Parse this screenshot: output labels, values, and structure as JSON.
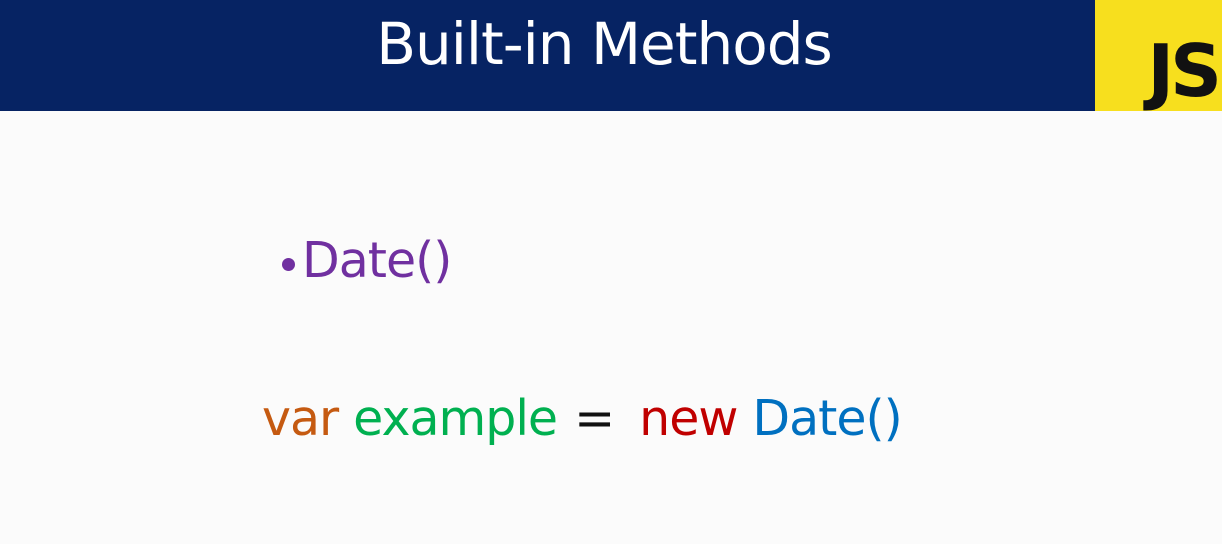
{
  "slide": {
    "title": "Built-in Methods",
    "logo_text": "JS",
    "bullet": {
      "text": "Date()"
    },
    "code": {
      "var_keyword": "var",
      "identifier": "example",
      "operator": "=",
      "new_keyword": "new",
      "constructor_call": "Date()"
    }
  },
  "colors": {
    "header_background": "#062363",
    "logo_background": "#f7df1e",
    "bullet_text": "#7030a0",
    "var_keyword": "#c55a11",
    "identifier": "#00b050",
    "new_keyword": "#c00000",
    "constructor_call": "#0070c0"
  },
  "icons": {
    "bullet": "bullet-dot-icon",
    "logo": "javascript-logo"
  }
}
